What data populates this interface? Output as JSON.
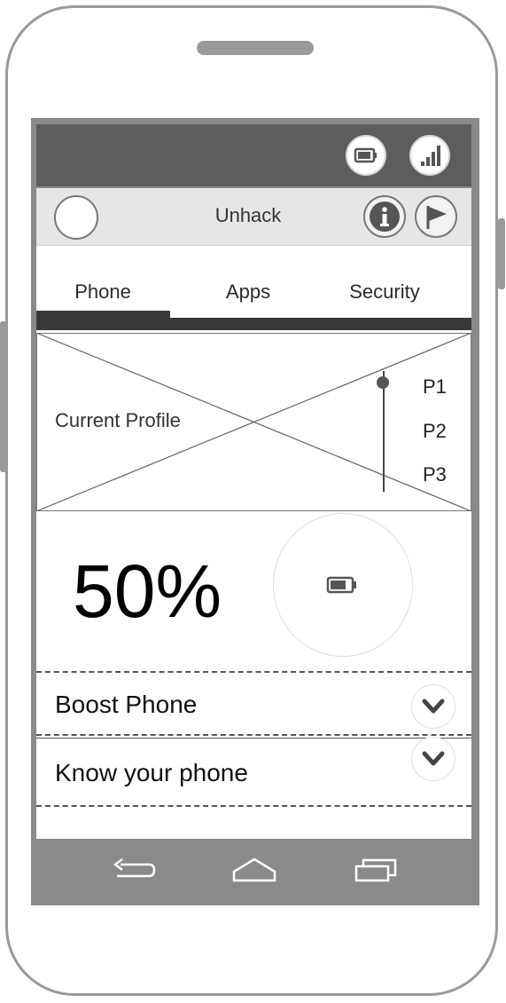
{
  "status_bar": {
    "icons": [
      "battery-icon",
      "signal-icon"
    ]
  },
  "header": {
    "title": "Unhack",
    "icons": [
      "avatar",
      "info-icon",
      "flag-icon"
    ]
  },
  "tabs": [
    {
      "label": "Phone",
      "active": true
    },
    {
      "label": "Apps",
      "active": false
    },
    {
      "label": "Security",
      "active": false
    }
  ],
  "profile": {
    "label": "Current Profile",
    "options": [
      "P1",
      "P2",
      "P3"
    ],
    "selected": "P1"
  },
  "battery": {
    "percent_text": "50%",
    "level": 0.5
  },
  "sections": [
    {
      "label": "Boost Phone",
      "icon": "chevron-down-icon"
    },
    {
      "label": "Know your phone",
      "icon": "chevron-down-icon"
    }
  ],
  "nav": {
    "icons": [
      "back-icon",
      "home-icon",
      "recent-apps-icon"
    ]
  },
  "colors": {
    "status_bar": "#5d5d5d",
    "nav_bar": "#8a8a8a",
    "tab_indicator": "#3a3a3a"
  }
}
